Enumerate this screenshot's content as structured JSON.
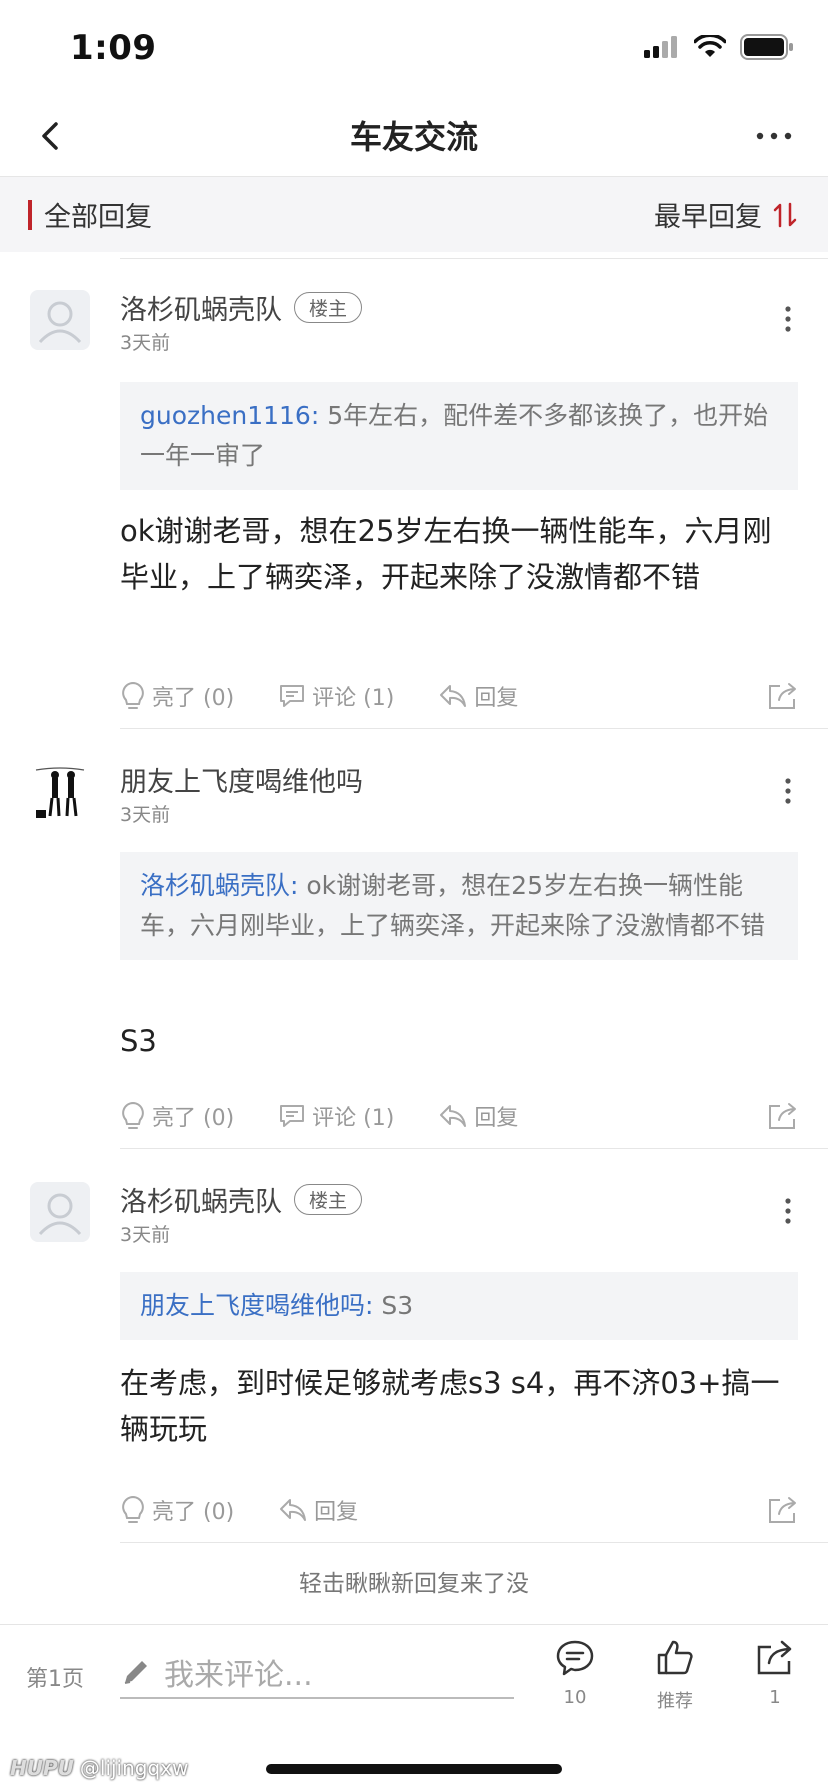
{
  "status_bar": {
    "time": "1:09"
  },
  "nav": {
    "title": "车友交流"
  },
  "sub_header": {
    "left_label": "全部回复",
    "right_label": "最早回复"
  },
  "replies": [
    {
      "author": "洛杉矶蜗壳队",
      "badge": "楼主",
      "time": "3天前",
      "quote_author": "guozhen1116:",
      "quote_text": " 5年左右，配件差不多都该换了，也开始一年一审了",
      "body": "ok谢谢老哥，想在25岁左右换一辆性能车，六月刚毕业，上了辆奕泽，开起来除了没激情都不错",
      "like": "亮了 (0)",
      "comment": "评论 (1)",
      "reply": "回复"
    },
    {
      "author": "朋友上飞度喝维他吗",
      "time": "3天前",
      "quote_author": "洛杉矶蜗壳队:",
      "quote_text": " ok谢谢老哥，想在25岁左右换一辆性能车，六月刚毕业，上了辆奕泽，开起来除了没激情都不错",
      "body": "S3",
      "like": "亮了 (0)",
      "comment": "评论 (1)",
      "reply": "回复"
    },
    {
      "author": "洛杉矶蜗壳队",
      "badge": "楼主",
      "time": "3天前",
      "quote_author": "朋友上飞度喝维他吗:",
      "quote_text": " S3",
      "body": "在考虑，到时候足够就考虑s3 s4，再不济03+搞一辆玩玩",
      "like": "亮了 (0)",
      "reply": "回复"
    }
  ],
  "load_more": "轻击瞅瞅新回复来了没",
  "bottom_bar": {
    "page": "第1页",
    "comment_placeholder": "我来评论...",
    "comments_count": "10",
    "recommend": "推荐",
    "share_count": "1"
  },
  "watermark": {
    "brand": "HUPU",
    "user": "@lijingqxw"
  },
  "colors": {
    "accent_red": "#c0242a",
    "link_blue": "#3a6fc4"
  },
  "icons": [
    "back-icon",
    "more-icon",
    "sort-icon",
    "kebab-icon",
    "lightbulb-icon",
    "comment-icon",
    "reply-icon",
    "share-icon",
    "pencil-icon"
  ]
}
